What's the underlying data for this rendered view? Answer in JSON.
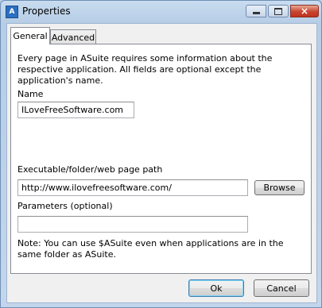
{
  "window": {
    "title": "Properties",
    "icon_label": "A"
  },
  "caption_buttons": {
    "minimize": "minimize-icon",
    "maximize": "maximize-icon",
    "close": "×"
  },
  "tabs": [
    {
      "label": "General",
      "active": true
    },
    {
      "label": "Advanced",
      "active": false
    }
  ],
  "general": {
    "description": "Every page in ASuite requires some information about the respective application. All fields are optional except the application's name.",
    "name_label": "Name",
    "name_value": "ILoveFreeSoftware.com",
    "path_label": "Executable/folder/web page path",
    "path_value": "http://www.ilovefreesoftware.com/",
    "browse_label": "Browse",
    "params_label": "Parameters (optional)",
    "params_value": "",
    "note": "Note: You can use $ASuite even when applications are in the same folder as ASuite."
  },
  "footer": {
    "ok_label": "Ok",
    "cancel_label": "Cancel"
  }
}
